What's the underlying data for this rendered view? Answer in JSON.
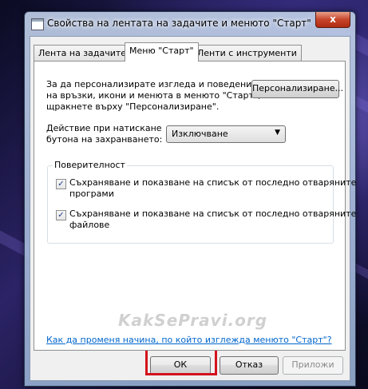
{
  "window": {
    "title": "Свойства на лентата на задачите и менюто \"Старт\"",
    "close_label": "x"
  },
  "tabs": [
    {
      "label": "Лента на задачите"
    },
    {
      "label": "Меню \"Старт\""
    },
    {
      "label": "Ленти с инструменти"
    }
  ],
  "start_menu": {
    "description_line1": "За да персонализирате изгледа и поведението",
    "description_line2": "на връзки, икони и менюта в менюто \"Старт\",",
    "description_line3": "щракнете върху \"Персонализиране\".",
    "customize_button": "Персонализиране...",
    "power_label_line1": "Действие при натискане",
    "power_label_line2": "бутона на захранването:",
    "power_value": "Изключване"
  },
  "privacy": {
    "title": "Поверителност",
    "programs_line1": "Съхраняване и показване на списък от последно отваряните",
    "programs_line2": "програми",
    "programs_checked": true,
    "files_line1": "Съхраняване и показване на списък от последно отваряните",
    "files_line2": "файлове",
    "files_checked": true
  },
  "watermark": "KakSePravi.org",
  "help_link": "Как да променя начина, по който изглежда менюто \"Старт\"?",
  "buttons": {
    "ok": "ОК",
    "cancel": "Отказ",
    "apply": "Приложи"
  },
  "colors": {
    "highlight": "#d3131b",
    "link": "#0066cc"
  }
}
